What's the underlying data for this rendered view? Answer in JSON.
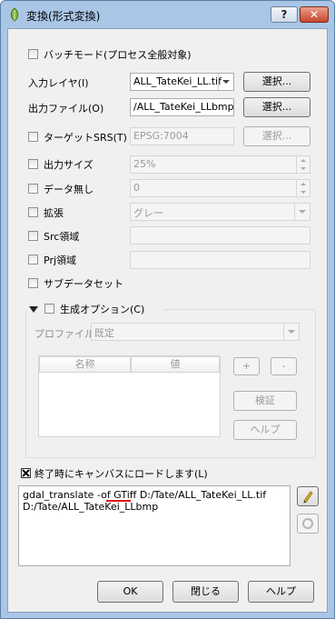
{
  "window": {
    "title": "変換(形式変換)",
    "help_label": "?",
    "close_label": "✕"
  },
  "batch_mode": {
    "label": "バッチモード(プロセス全般対象)",
    "checked": false
  },
  "input_layer": {
    "label": "入力レイヤ(I)",
    "value": "ALL_TateKei_LL.tif",
    "select_label": "選択..."
  },
  "output_file": {
    "label": "出力ファイル(O)",
    "value": "/ALL_TateKei_LLbmp",
    "select_label": "選択..."
  },
  "target_srs": {
    "label": "ターゲットSRS(T)",
    "value": "EPSG:7004",
    "select_label": "選択..."
  },
  "output_size": {
    "label": "出力サイズ",
    "value": "25%"
  },
  "no_data": {
    "label": "データ無し",
    "value": "0"
  },
  "expand": {
    "label": "拡張",
    "value": "グレー"
  },
  "src_window": {
    "label": "Src領域"
  },
  "prj_window": {
    "label": "Prj領域"
  },
  "sub_dataset": {
    "label": "サブデータセット"
  },
  "creation_options": {
    "label": "生成オプション(C)",
    "profile_label": "プロファイル",
    "profile_value": "既定",
    "columns": [
      "名称",
      "値"
    ],
    "add_label": "+",
    "remove_label": "-",
    "validate_label": "検証",
    "help_label": "ヘルプ"
  },
  "load_into_canvas": {
    "label": "終了時にキャンバスにロードします(L)",
    "checked": true
  },
  "command": {
    "line1": "gdal_translate -of GTiff D:/Tate/ALL_TateKei_LL.tif",
    "line2": "D:/Tate/ALL_TateKei_LLbmp"
  },
  "footer": {
    "ok_label": "OK",
    "close_label": "閉じる",
    "help_label": "ヘルプ"
  },
  "colors": {
    "titlebar": "#a9c6e6",
    "client": "#f0f0f0",
    "close": "#c8462c",
    "annotation": "#e01010"
  }
}
